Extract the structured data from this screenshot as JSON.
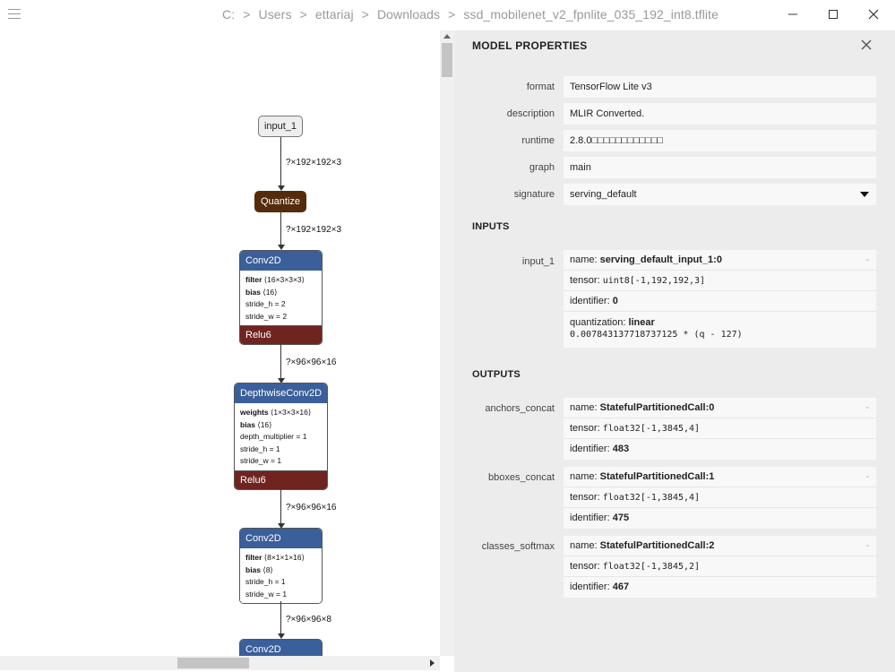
{
  "window": {
    "breadcrumb": [
      "C:",
      "Users",
      "ettariaj",
      "Downloads",
      "ssd_mobilenet_v2_fpnlite_035_192_int8.tflite"
    ],
    "separator": ">"
  },
  "graph": {
    "input_node": "input_1",
    "quantize_node": "Quantize",
    "edges": [
      "?×192×192×3",
      "?×192×192×3",
      "?×96×96×16",
      "?×96×96×16",
      "?×96×96×8"
    ],
    "conv1": {
      "title": "Conv2D",
      "filter_label": "filter",
      "filter_value": "⟨16×3×3×3⟩",
      "bias_label": "bias",
      "bias_value": "⟨16⟩",
      "stride_h": "stride_h = 2",
      "stride_w": "stride_w = 2",
      "activation": "Relu6"
    },
    "dwconv": {
      "title": "DepthwiseConv2D",
      "weights_label": "weights",
      "weights_value": "⟨1×3×3×16⟩",
      "bias_label": "bias",
      "bias_value": "⟨16⟩",
      "depth_multiplier": "depth_multiplier = 1",
      "stride_h": "stride_h = 1",
      "stride_w": "stride_w = 1",
      "activation": "Relu6"
    },
    "conv2": {
      "title": "Conv2D",
      "filter_label": "filter",
      "filter_value": "⟨8×1×1×16⟩",
      "bias_label": "bias",
      "bias_value": "⟨8⟩",
      "stride_h": "stride_h = 1",
      "stride_w": "stride_w = 1"
    },
    "conv3": {
      "title": "Conv2D"
    }
  },
  "properties": {
    "title": "MODEL PROPERTIES",
    "format_label": "format",
    "format_value": "TensorFlow Lite v3",
    "description_label": "description",
    "description_value": "MLIR Converted.",
    "runtime_label": "runtime",
    "runtime_value": "2.8.0□□□□□□□□□□□□",
    "graph_label": "graph",
    "graph_value": "main",
    "signature_label": "signature",
    "signature_value": "serving_default",
    "inputs_title": "INPUTS",
    "outputs_title": "OUTPUTS",
    "name_prefix": "name: ",
    "tensor_prefix": "tensor: ",
    "identifier_prefix": "identifier: ",
    "quantization_prefix": "quantization: ",
    "collapse_symbol": "-",
    "inputs": [
      {
        "label": "input_1",
        "name": "serving_default_input_1:0",
        "tensor": "uint8[-1,192,192,3]",
        "identifier": "0",
        "quantization": "linear",
        "quantization_formula": "0.007843137718737125 * (q - 127)"
      }
    ],
    "outputs": [
      {
        "label": "anchors_concat",
        "name": "StatefulPartitionedCall:0",
        "tensor": "float32[-1,3845,4]",
        "identifier": "483"
      },
      {
        "label": "bboxes_concat",
        "name": "StatefulPartitionedCall:1",
        "tensor": "float32[-1,3845,4]",
        "identifier": "475"
      },
      {
        "label": "classes_softmax",
        "name": "StatefulPartitionedCall:2",
        "tensor": "float32[-1,3845,2]",
        "identifier": "467"
      }
    ]
  }
}
